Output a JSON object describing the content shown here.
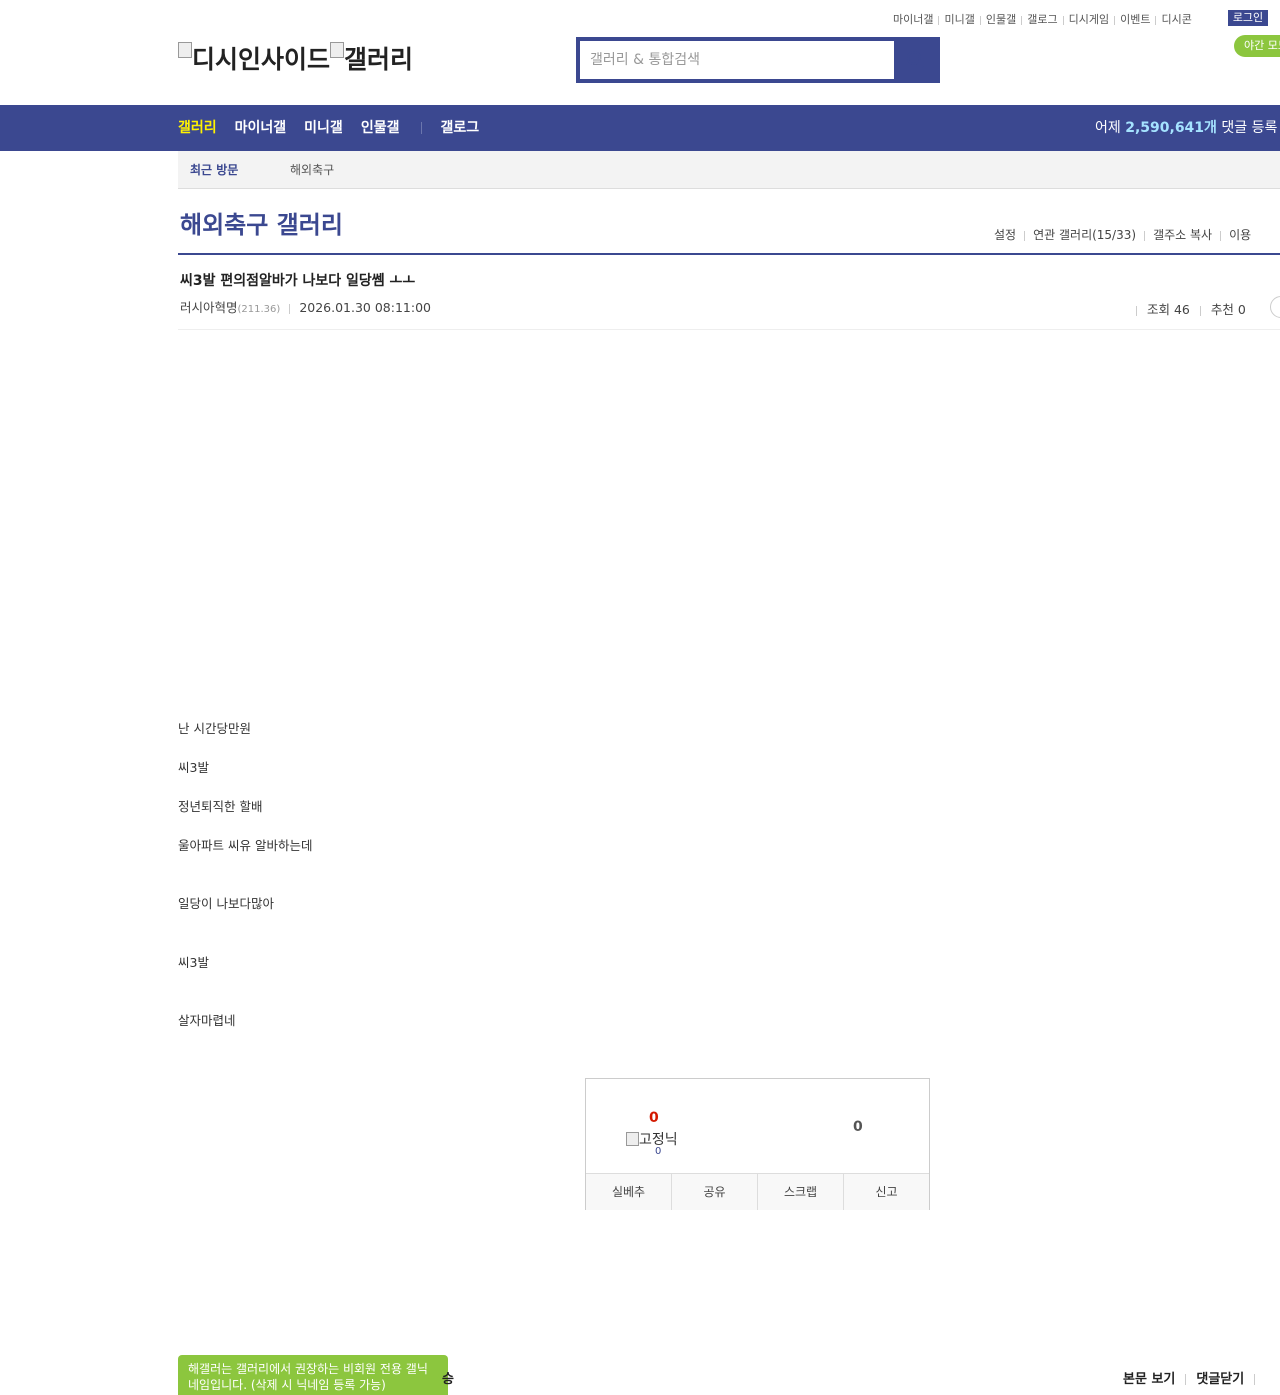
{
  "top_links": [
    "마이너갤",
    "미니갤",
    "인물갤",
    "갤로그",
    "디시게임",
    "이벤트",
    "디시콘"
  ],
  "login_label": "로그인",
  "night_mode_label": "야간 모드",
  "logo": {
    "site": "디시인사이드",
    "section": "갤러리"
  },
  "search": {
    "placeholder": "갤러리 & 통합검색"
  },
  "nav": {
    "items": [
      "갤러리",
      "마이너갤",
      "미니갤",
      "인물갤"
    ],
    "extra": "갤로그",
    "stat_prefix": "어제 ",
    "stat_value": "2,590,641개",
    "stat_suffix": " 댓글 등록"
  },
  "recent": {
    "label": "최근 방문",
    "item": "해외축구"
  },
  "gallery": {
    "title": "해외축구 갤러리",
    "menu": [
      "설정",
      "연관 갤러리(15/33)",
      "갤주소 복사",
      "이용"
    ]
  },
  "post": {
    "title": "씨3발 편의점알바가 나보다 일당쎔 ㅗㅗ",
    "author": "러시아혁명",
    "ip": "(211.36)",
    "date": "2026.01.30 08:11:00",
    "views_label": "조회 46",
    "recommend_label": "추천 0",
    "body": [
      "난 시간당만원",
      "씨3발",
      "정년퇴직한 할배",
      "울아파트 씨유 알바하는데",
      "일당이 나보다많아",
      "씨3발",
      "살자마렵네"
    ]
  },
  "recommend_box": {
    "up_count": "0",
    "fixed_nick_label": "고정닉",
    "fixed_count": "0",
    "down_count": "0",
    "buttons": [
      "실베추",
      "공유",
      "스크랩",
      "신고"
    ]
  },
  "bottom": {
    "tip": "해갤러는 갤러리에서 권장하는 비회원 전용 갤닉네임입니다. (삭제 시 닉네임 등록 가능)",
    "tail_char": "승",
    "links": [
      "본문 보기",
      "댓글닫기"
    ]
  }
}
